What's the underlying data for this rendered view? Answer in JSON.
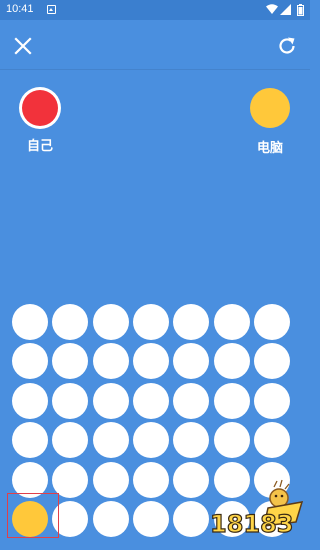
{
  "status_bar": {
    "time": "10:41",
    "app_icon": "app-notification-icon",
    "icons": [
      "wifi-icon",
      "signal-icon",
      "battery-icon"
    ]
  },
  "toolbar": {
    "close_icon": "close-icon",
    "restart_icon": "restart-icon"
  },
  "players": {
    "self": {
      "label": "自己",
      "color": "#f2323b"
    },
    "computer": {
      "label": "电脑",
      "color": "#ffc83a"
    }
  },
  "board": {
    "columns": 7,
    "rows": 6,
    "empty_color": "#ffffff",
    "discs": [
      {
        "row": 6,
        "column": 1,
        "color": "yellow"
      }
    ],
    "highlighted_cell": {
      "row": 6,
      "column": 1
    }
  },
  "colors": {
    "background": "#4a8fdf",
    "status_bar": "#3b7fcf",
    "yellow": "#ffc83a",
    "red": "#f2323b"
  },
  "watermark": {
    "text": "18183"
  }
}
